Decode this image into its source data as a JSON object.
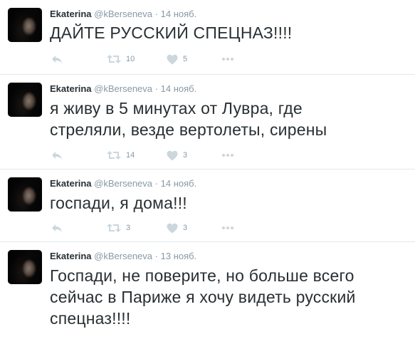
{
  "tweets": [
    {
      "name": "Ekaterina",
      "handle": "@kBerseneva",
      "separator": "·",
      "time": "14 нояб.",
      "lines": [
        "ДАЙТЕ РУССКИЙ СПЕЦНАЗ!!!!"
      ],
      "retweets": "10",
      "likes": "5"
    },
    {
      "name": "Ekaterina",
      "handle": "@kBerseneva",
      "separator": "·",
      "time": "14 нояб.",
      "lines": [
        "я живу в 5 минутах от Лувра, где",
        "стреляли, везде вертолеты, сирены"
      ],
      "retweets": "14",
      "likes": "3"
    },
    {
      "name": "Ekaterina",
      "handle": "@kBerseneva",
      "separator": "·",
      "time": "14 нояб.",
      "lines": [
        "госпади, я дома!!!"
      ],
      "retweets": "3",
      "likes": "3"
    },
    {
      "name": "Ekaterina",
      "handle": "@kBerseneva",
      "separator": "·",
      "time": "13 нояб.",
      "lines": [
        "Госпади, не поверите, но больше всего",
        "сейчас в Париже я хочу видеть русский",
        "спецназ!!!!"
      ],
      "retweets": "",
      "likes": ""
    }
  ],
  "icons": {
    "reply": "reply-icon",
    "retweet": "retweet-icon",
    "like": "heart-icon",
    "more": "more-icon"
  },
  "colors": {
    "icon": "#ccd6dd",
    "meta": "#8899a6",
    "text": "#292f33",
    "divider": "#e1e8ed"
  }
}
